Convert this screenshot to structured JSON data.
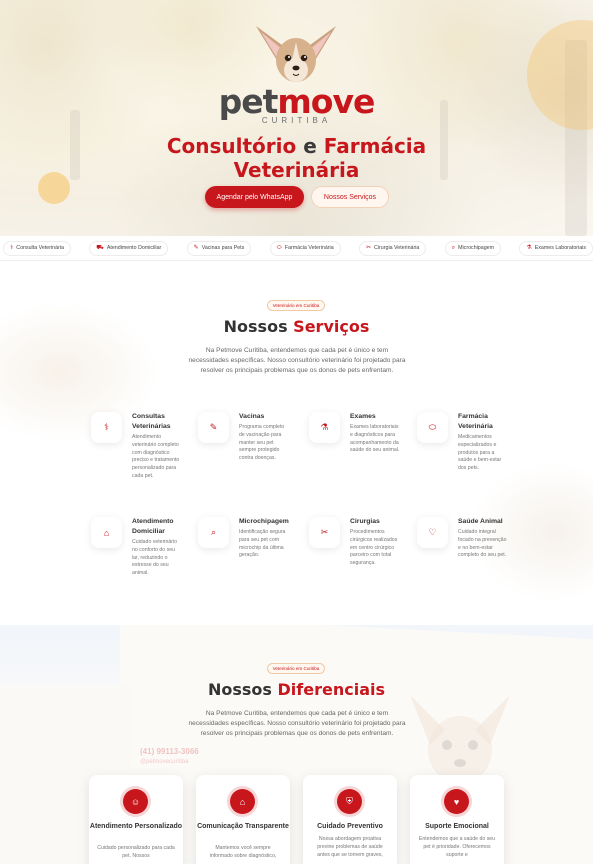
{
  "hero": {
    "brand_pet": "pet",
    "brand_move": "move",
    "brand_city": "CURITIBA",
    "title_part1": "Consultório",
    "title_and": "e",
    "title_part2": "Farmácia",
    "title_line2": "Veterinária",
    "primary_button": "Agendar pelo WhatsApp",
    "secondary_button": "Nossos Serviços"
  },
  "quick_links": [
    {
      "label": "Consulta Veterinária",
      "icon": "stethoscope-icon"
    },
    {
      "label": "Atendimento Domiciliar",
      "icon": "car-icon"
    },
    {
      "label": "Vacinas para Pets",
      "icon": "syringe-icon"
    },
    {
      "label": "Farmácia Veterinária",
      "icon": "pill-icon"
    },
    {
      "label": "Cirurgia Veterinária",
      "icon": "scissors-icon"
    },
    {
      "label": "Microchipagem",
      "icon": "search-icon"
    },
    {
      "label": "Exames Laboratoriais",
      "icon": "flask-icon"
    }
  ],
  "services": {
    "badge": "Veterinário em Curitiba",
    "title_plain": "Nossos",
    "title_accent": "Serviços",
    "description": "Na Petmove Curitiba, entendemos que cada pet é único e tem necessidades específicas. Nosso consultório veterinário foi projetado para resolver os principais problemas que os donos de pets enfrentam.",
    "items": [
      {
        "title": "Consultas Veterinárias",
        "icon": "stethoscope-icon",
        "text": "Atendimento veterinário completo com diagnóstico preciso e tratamento personalizado para cada pet."
      },
      {
        "title": "Vacinas",
        "icon": "syringe-icon",
        "text": "Programa completo de vacinação para manter seu pet sempre protegido contra doenças."
      },
      {
        "title": "Exames",
        "icon": "flask-icon",
        "text": "Exames laboratoriais e diagnósticos para acompanhamento da saúde do seu animal."
      },
      {
        "title": "Farmácia Veterinária",
        "icon": "pill-icon",
        "text": "Medicamentos especializados e produtos para a saúde e bem-estar dos pets."
      },
      {
        "title": "Atendimento Domiciliar",
        "icon": "home-icon",
        "text": "Cuidado veterinário no conforto do seu lar, reduzindo o estresse do seu animal."
      },
      {
        "title": "Microchipagem",
        "icon": "search-icon",
        "text": "Identificação segura para seu pet com microchip da última geração."
      },
      {
        "title": "Cirurgias",
        "icon": "scissors-icon",
        "text": "Procedimentos cirúrgicos realizados em centro cirúrgico parceiro com total segurança."
      },
      {
        "title": "Saúde Animal",
        "icon": "heart-icon",
        "text": "Cuidado integral focado na prevenção e no bem-estar completo do seu pet."
      }
    ]
  },
  "differentials": {
    "badge": "Veterinário em Curitiba",
    "title_plain": "Nossos",
    "title_accent": "Diferenciais",
    "description": "Na Petmove Curitiba, entendemos que cada pet é único e tem necessidades específicas. Nosso consultório veterinário foi projetado para resolver os principais problemas que os donos de pets enfrentam.",
    "background_phone": "(41) 99113-3066",
    "background_email": "@petmovecuritiba",
    "cards": [
      {
        "title": "Atendimento Personalizado",
        "icon": "user-icon",
        "text": "Cuidado personalizado para cada pet. Nossos"
      },
      {
        "title": "Comunicação Transparente",
        "icon": "home-icon",
        "text": "Mantemos você sempre informado sobre diagnóstico,"
      },
      {
        "title": "Cuidado Preventivo",
        "icon": "shield-icon",
        "text": "Nossa abordagem proativa previne problemas de saúde antes que se tornem graves,"
      },
      {
        "title": "Suporte Emocional",
        "icon": "heart-icon",
        "text": "Entendemos que a saúde do seu pet é prioridade. Oferecemos suporte e"
      }
    ]
  },
  "colors": {
    "brand_red": "#c8161d",
    "brand_gray": "#4a4a4a",
    "accent_orange": "#f7c15e"
  }
}
